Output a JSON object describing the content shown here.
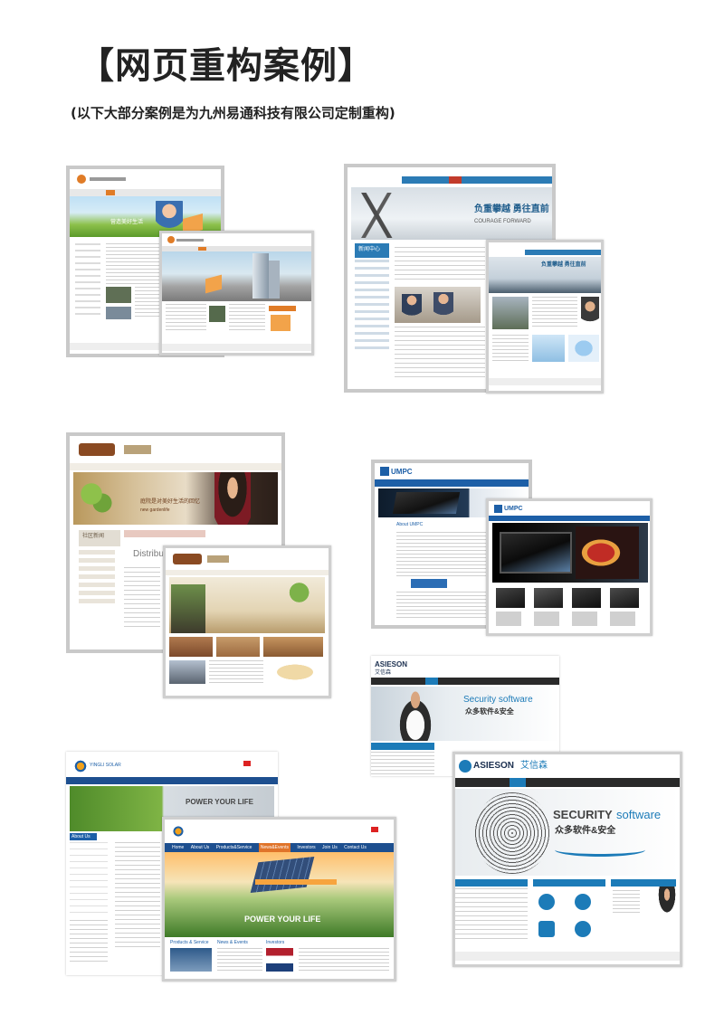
{
  "header": {
    "title": "【网页重构案例】",
    "subtitle": "(以下大部分案例是为九州易通科技有限公司定制重构)"
  },
  "case1": {
    "banner_text": "营造美好生活"
  },
  "case2": {
    "hero_text_cn": "负重攀越 勇往直前",
    "hero_text_en": "COURAGE FORWARD",
    "section_label": "新闻中心",
    "hero_text_cn_small": "负重攀越 勇往直前"
  },
  "case3": {
    "community_label": "社区新闻",
    "distribution_label": "Distributi",
    "banner_cn": "庭院是对美好生活的回忆",
    "banner_en": "new gardenlife"
  },
  "case4": {
    "brand": "UMPC",
    "brand2": "UMPC",
    "about_label": "About UMPC"
  },
  "case5": {
    "brand_en": "ASIESON",
    "brand_cn": "艾信森",
    "hero_en": "Security software",
    "hero_cn": "众多软件&安全",
    "brand_en_2": "ASIESON",
    "brand_cn_2": "艾信森",
    "hero2_en_a": "SECURITY",
    "hero2_en_b": "software",
    "hero2_cn": "众多软件&安全"
  },
  "case6": {
    "brand": "YINGLI SOLAR",
    "hero_text": "POWER YOUR LIFE",
    "hero_text_2": "POWER YOUR LIFE",
    "about_label": "About Us",
    "nav": [
      "Home",
      "About Us",
      "Products&Service",
      "News&Events",
      "Investors",
      "Join Us",
      "Contact Us"
    ],
    "sub_labels": [
      "Products & Service",
      "News & Events",
      "Investors"
    ]
  },
  "colors": {
    "frame": "#c9c9c9",
    "green": "#5a9a2e",
    "blue": "#2c6ea6",
    "dark": "#333333",
    "orange": "#e0742a",
    "brown": "#7a3e1e"
  }
}
